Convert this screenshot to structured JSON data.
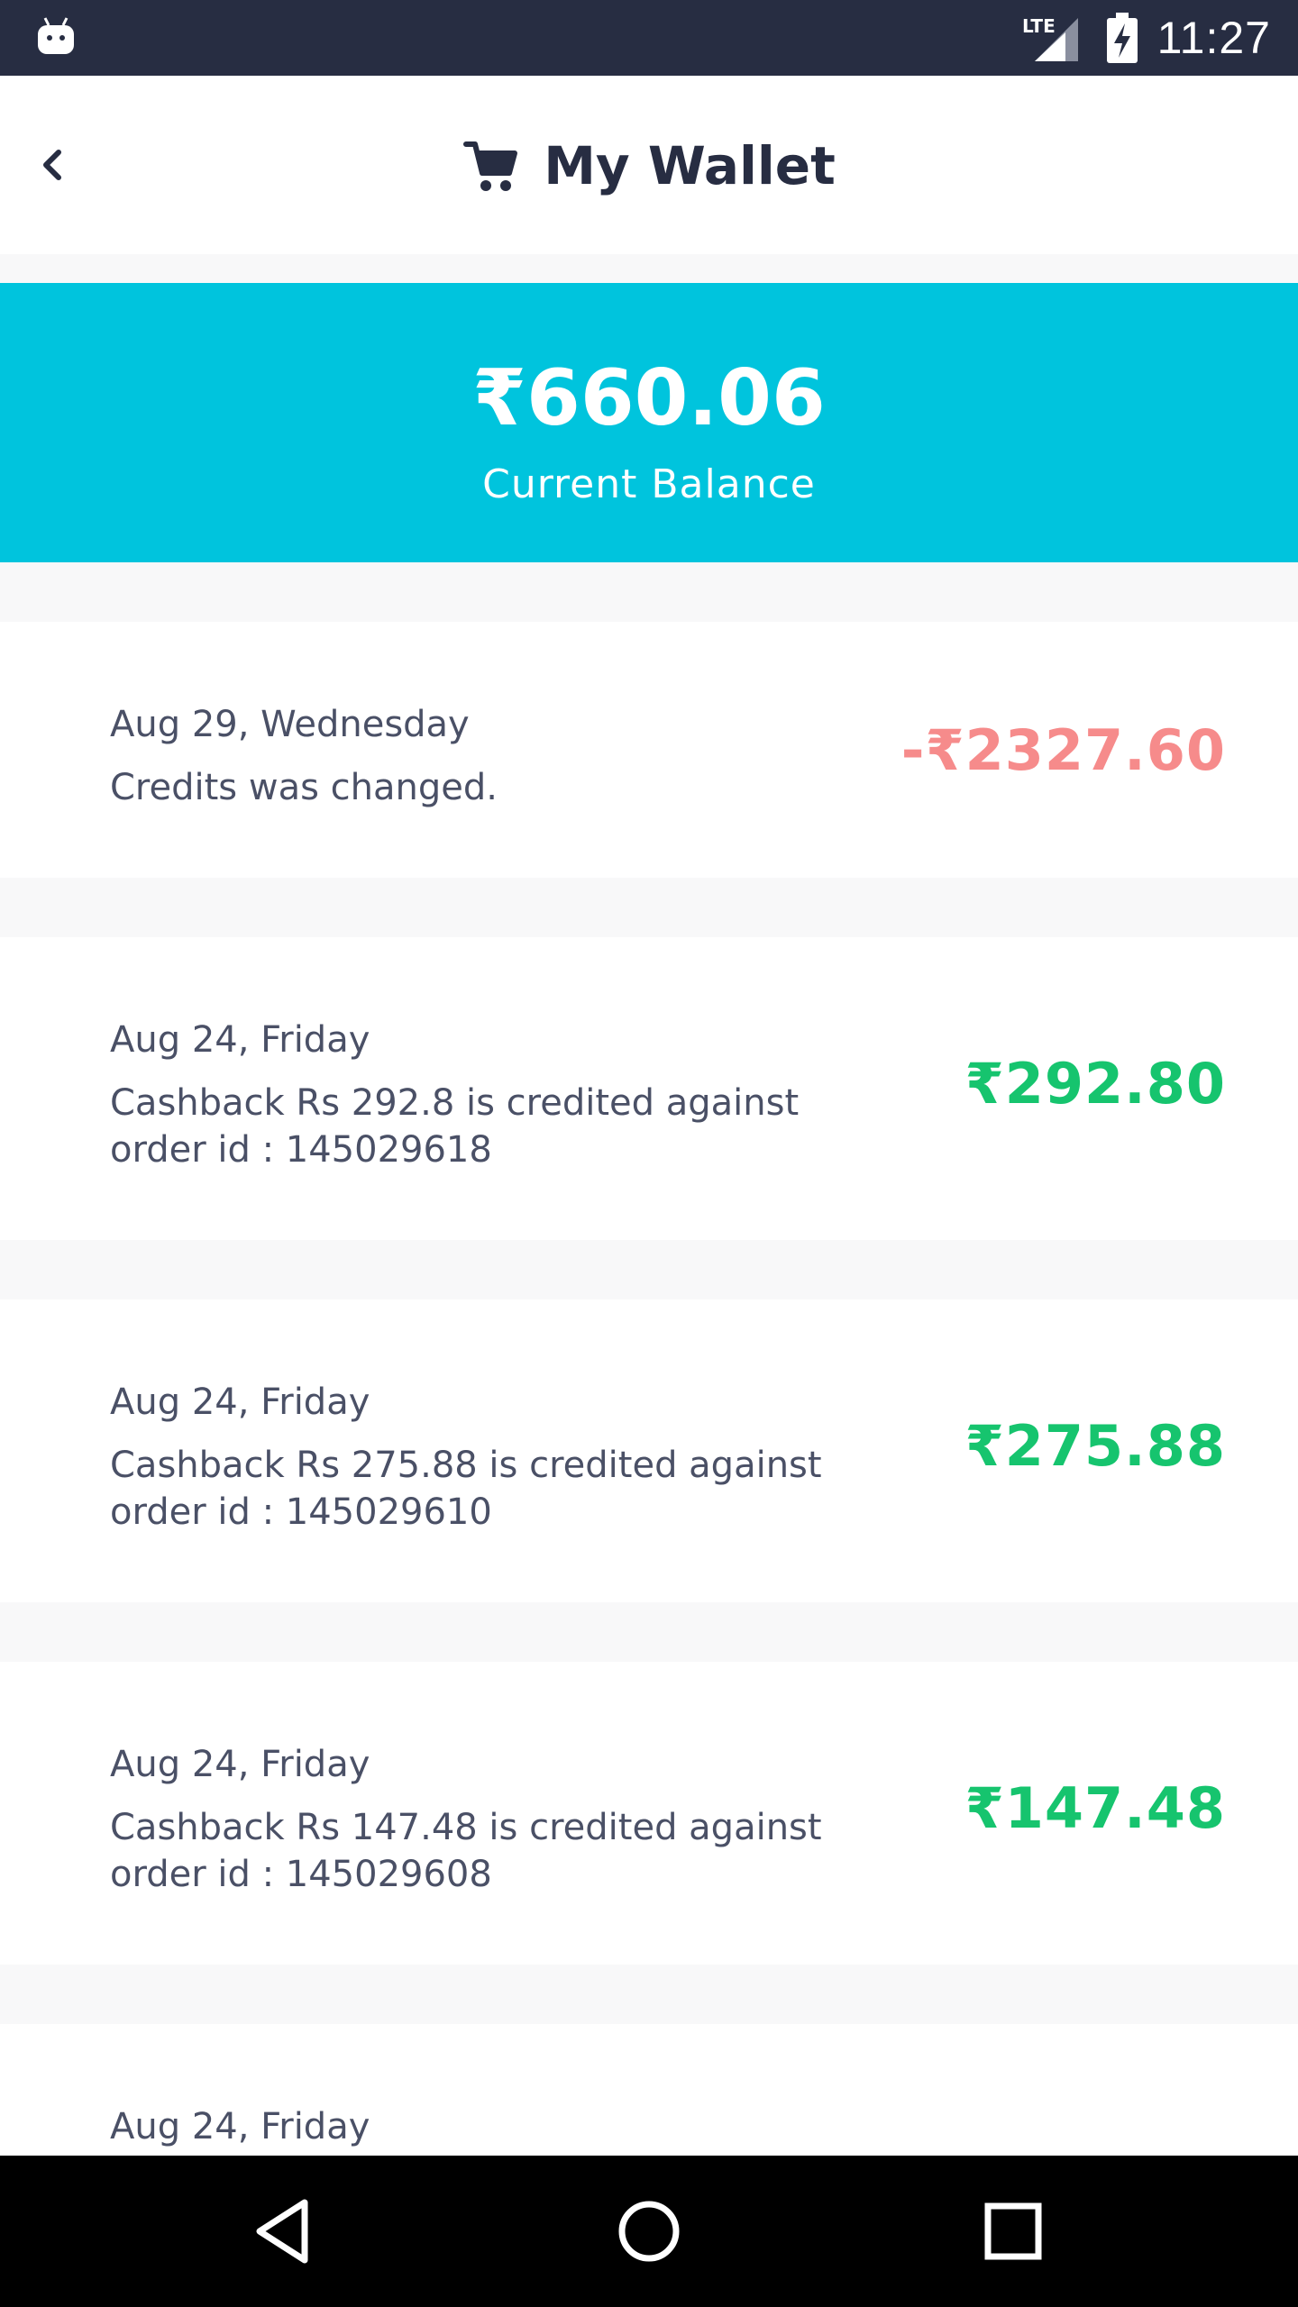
{
  "status_bar": {
    "time": "11:27",
    "icons": [
      "android-icon",
      "lte-signal-icon",
      "battery-charging-icon"
    ]
  },
  "app_bar": {
    "title": "My Wallet",
    "icons": [
      "back-chevron-icon",
      "shopping-cart-icon"
    ]
  },
  "balance": {
    "amount": "₹660.06",
    "label": "Current Balance",
    "color": "#00c4dd"
  },
  "colors": {
    "debit": "#f68b8b",
    "credit": "#16c46e",
    "text": "#4a5066"
  },
  "transactions": [
    {
      "date": "Aug 29, Wednesday",
      "description": "Credits was changed.",
      "amount": "-₹2327.60",
      "type": "debit"
    },
    {
      "date": "Aug 24, Friday",
      "description": "Cashback Rs 292.8 is credited against order id : 145029618",
      "amount": "₹292.80",
      "type": "credit"
    },
    {
      "date": "Aug 24, Friday",
      "description": "Cashback Rs 275.88 is credited against order id : 145029610",
      "amount": "₹275.88",
      "type": "credit"
    },
    {
      "date": "Aug 24, Friday",
      "description": "Cashback Rs 147.48 is credited against order id : 145029608",
      "amount": "₹147.48",
      "type": "credit"
    },
    {
      "date": "Aug 24, Friday",
      "description": "",
      "amount": "",
      "type": "credit"
    }
  ],
  "nav_bar": {
    "icons": [
      "back-triangle-icon",
      "home-circle-icon",
      "recents-square-icon"
    ]
  }
}
